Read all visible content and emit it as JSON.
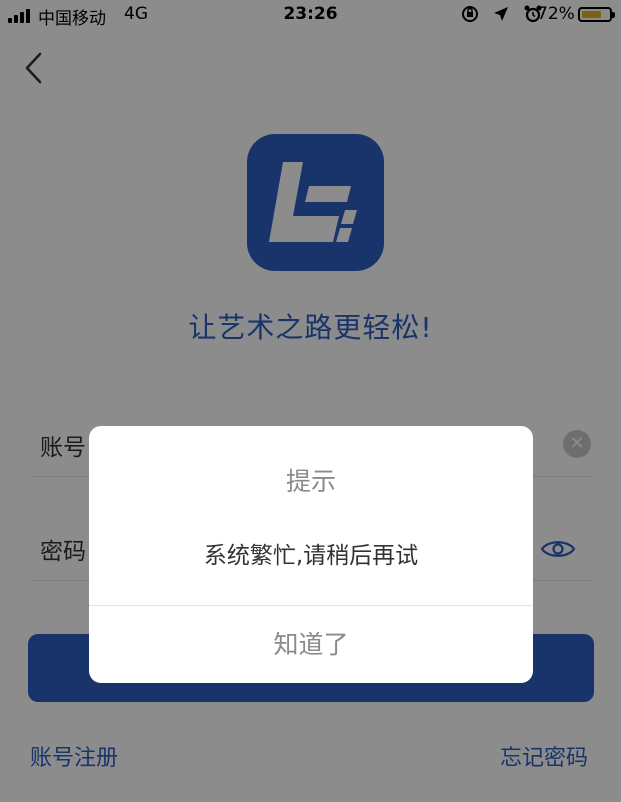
{
  "status_bar": {
    "carrier": "中国移动",
    "network": "4G",
    "time": "23:26",
    "battery_percent": "72%",
    "battery_level": 0.72,
    "icons": [
      "signal-icon",
      "screen-rotation-lock-icon",
      "location-icon",
      "alarm-icon",
      "battery-icon"
    ]
  },
  "header": {
    "back_icon": "chevron-left-icon"
  },
  "app": {
    "logo_icon": "app-logo-icon",
    "slogan": "让艺术之路更轻松!"
  },
  "form": {
    "account_label": "账号",
    "password_label": "密码",
    "clear_icon": "clear-icon",
    "visibility_icon": "eye-icon",
    "login_button_label": ""
  },
  "links": {
    "register": "账号注册",
    "forgot_password": "忘记密码"
  },
  "dialog": {
    "title": "提示",
    "message": "系统繁忙,请稍后再试",
    "confirm_button": "知道了"
  },
  "colors": {
    "brand_blue": "#2d5fc4",
    "overlay": "rgba(0,0,0,0.45)",
    "battery": "#e0b21c"
  }
}
